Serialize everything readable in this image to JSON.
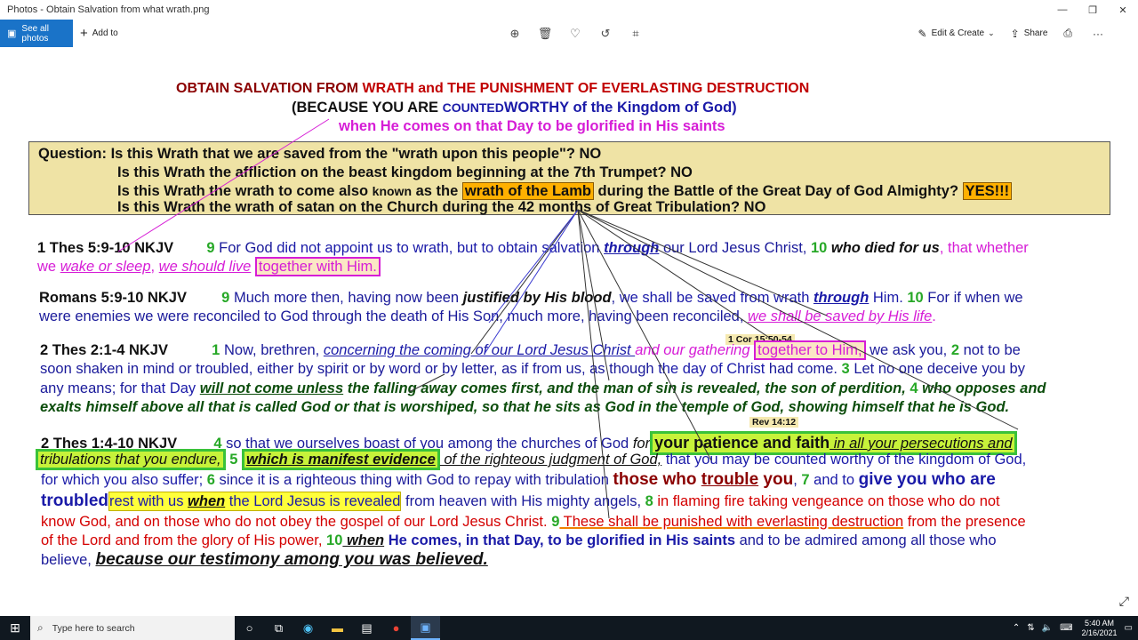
{
  "window": {
    "title": "Photos - Obtain Salvation from what wrath.png",
    "minimize": "—",
    "restore": "❐",
    "close": "✕"
  },
  "toolbar": {
    "see_all_label": "See all photos",
    "add_to_label": "Add to",
    "edit_create_label": "Edit & Create",
    "share_label": "Share"
  },
  "slide": {
    "header": {
      "line1_a": "OBTAIN SALVATION FROM ",
      "line1_b": "WRATH and THE PUNISHMENT OF EVERLASTING DESTRUCTION",
      "line2_a": "(BECAUSE YOU ARE ",
      "line2_b": "COUNTED",
      "line2_c": "WORTHY of the Kingdom of God)",
      "line3": "when He comes on that Day to be glorified in His saints"
    },
    "question": {
      "q1": "Question: Is this Wrath that we are saved from the \"wrath upon this people\"? NO",
      "q2": "Is this Wrath the affliction on the beast kingdom beginning at the 7th Trumpet? NO",
      "q3_a": "Is this Wrath the wrath to come also ",
      "q3_b": "known",
      "q3_c": " as the ",
      "q3_d": "wrath of the Lamb",
      "q3_e": " during the Battle of the Great Day of God Almighty? ",
      "q3_f": "YES!!!",
      "q4": "Is this Wrath the wrath of satan on the Church during the 42 months of Great Tribulation? NO"
    },
    "thes1": {
      "ref": "1 Thes 5:9-10 NKJV",
      "v9": "9",
      "a": " For God ",
      "b": "did not appoint us to wrath, but to obtain salvation ",
      "c": "through",
      "d": " our Lord Jesus Christ,",
      "v10": " 10 ",
      "e": "who died for us",
      "f": ", that whether",
      "g": "we ",
      "h": "wake or sleep",
      "i": ", ",
      "j": "we should live",
      "k": "together with Him."
    },
    "romans": {
      "ref": "Romans 5:9-10 NKJV",
      "v9": "9",
      "a": " Much more then, having now been ",
      "b": "justified by His blood",
      "c": ", ",
      "d": "we shall be saved from wrath ",
      "e": "through",
      "f": " Him.",
      "v10": " 10",
      "g": " For if when we",
      "h": "were enemies we were reconciled to God through the death of His Son, much more, having been reconciled, ",
      "i": "we shall be saved by His life",
      "j": "."
    },
    "thes2": {
      "note": "1 Cor 15:50-54",
      "ref": "2 Thes 2:1-4 NKJV",
      "v1": "1",
      "a": " Now, brethren, ",
      "b": "concerning the coming of our Lord Jesus Christ ",
      "c": "and our gathering",
      "d": "together to Him,",
      "e": " we ask you, ",
      "v2": "2",
      "f": " not to be",
      "g": "soon shaken in mind or troubled, either by spirit or by word or by letter, as if from us, as though ",
      "h": "the day of Christ",
      "i": " had come. ",
      "v3": "3",
      "j": " Let no one deceive you by",
      "k": "any means; for ",
      "l": "that Day ",
      "m": "will not come unless",
      "n": " the falling away comes first, and the man of sin is revealed, the son of perdition, ",
      "v4": "4",
      "o": " who opposes and",
      "p": "exalts himself above all that is called God or that is worshiped, so that he sits as God in the temple of God, showing himself that he is God."
    },
    "thes3": {
      "note": "Rev 14:12",
      "ref": "2 Thes 1:4-10 NKJV",
      "v4": "4",
      "a": " so that we ourselves boast of you among the churches of God ",
      "b": "for",
      "c": "your patience and faith",
      "d": " in all your persecutions and",
      "e": "tribulations that you endure,",
      "v5": " 5 ",
      "f": "which is manifest evidence",
      "g": " of the righteous judgment of God,",
      "h": " that you may be counted worthy of the kingdom of God,",
      "i": "for which you also suffer;",
      "v6": " 6",
      "j": " since it is a righteous thing with God to repay with tribulation ",
      "k": "those who ",
      "l": "trouble",
      "m": " you",
      "n": ", ",
      "v7": "7",
      "o": " and to ",
      "p": "give you who are",
      "q": "troubled",
      "r": " rest with us ",
      "s": "when",
      "t": " the Lord Jesus is revealed",
      "u": " from heaven with His mighty angels, ",
      "v8": "8",
      "v": " in flaming fire taking vengeance on those who do not",
      "w": "know God, and on those who do not obey the gospel of our Lord Jesus Christ. ",
      "v9": "9",
      "x": " These shall be punished with everlasting destruction",
      "y": " from the presence",
      "z": "of the Lord and from the glory of His power, ",
      "v10": "10",
      "aa": " when",
      "bb": " He comes, in that Day, to be glorified in His saints",
      "cc": " and to be admired among all those who",
      "dd": "believe, ",
      "ee": "because our testimony among you was believed."
    }
  },
  "taskbar": {
    "search_placeholder": "Type here to search",
    "time": "5:40 AM",
    "date": "2/16/2021"
  },
  "colors": {
    "accent": "#1a73c8",
    "question_bg": "#efe3a5",
    "taskbar": "#101820"
  }
}
